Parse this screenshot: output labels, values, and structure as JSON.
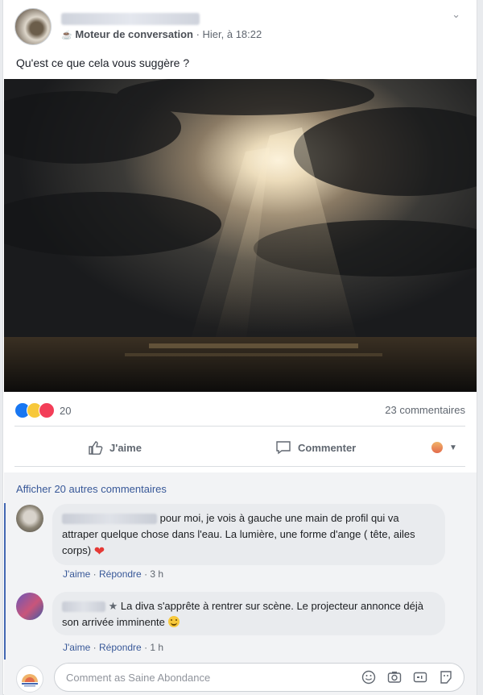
{
  "post": {
    "author_blurred": true,
    "group_name": "Moteur de conversation",
    "time": " · Hier, à 18:22",
    "text": "Qu'est ce que cela vous suggère ?",
    "reaction_count": "20",
    "comment_count": "23 commentaires"
  },
  "actions": {
    "like": "J'aime",
    "comment": "Commenter"
  },
  "comments_section": {
    "more_link": "Afficher 20 autres commentaires",
    "comments": [
      {
        "text": "pour moi, je vois à gauche une main de profil qui va attraper quelque chose dans l'eau. La lumière, une forme d'ange ( tête, ailes corps)",
        "like": "J'aime",
        "reply": "Répondre",
        "age": "3 h"
      },
      {
        "text": "La diva s'apprête à rentrer sur scène. Le projecteur annonce déjà son arrivée imminente",
        "like": "J'aime",
        "reply": "Répondre",
        "age": "1 h"
      }
    ]
  },
  "composer": {
    "placeholder": "Comment as Saine Abondance"
  },
  "colors": {
    "link": "#385898",
    "like_blue": "#1877f2",
    "love_red": "#f33e58",
    "wow_yellow": "#f7c83b",
    "thread_bar": "#4267b2"
  }
}
